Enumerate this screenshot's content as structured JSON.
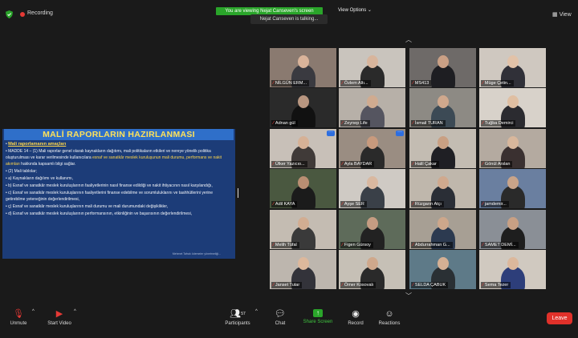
{
  "topbar": {
    "recording_label": "Recording",
    "view_notice": "You are viewing Nejat Canseven's screen",
    "view_options_label": "View Options",
    "talking_label": "Nejat Canseven is talking...",
    "view_button_label": "View"
  },
  "slide": {
    "title": "MALİ RAPORLARIN HAZIRLANMASI",
    "subtitle": "Mali raporlamanın amaçları",
    "paragraph_1_lead": "MADDE 14 – (1) Mali raporlar genel olarak kaynakların dağıtımı, mali politikaların etkileri ve nereye yönelik politika oluşturulması ve karar verilmesinde kullanıcılara",
    "paragraph_1_hl": "esnaf ve sanatkâr meslek kuruluşunun mali durumu, performans ve nakit akımları",
    "paragraph_1_tail": "hakkında kapsamlı bilgi sağlar.",
    "item_2": "(2) Mali tablolar;",
    "item_a": "a) Kaynakların dağılımı ve kullanımı,",
    "item_b": "b) Esnaf ve sanatkâr meslek kuruluşlarının faaliyetlerinin nasıl finanse edildiği ve nakit ihtiyacının nasıl karşılandığı,",
    "item_c": "c) Esnaf ve sanatkâr meslek kuruluşlarının faaliyetlerini finanse edebilme ve sorumluluklarını ve taahhütlerini yerine getirebilme yeteneğinin değerlendirilmesi,",
    "item_c2": "ç) Esnaf ve sanatkâr meslek kuruluşlarının mali durumu ve mali durumundaki değişiklikler,",
    "item_d": "d) Esnaf ve sanatkâr meslek kuruluşlarının performansının, etkinliğinin ve başarısının değerlendirilmesi,",
    "footnote": "Mehmet Tafralı ödemeler yönetmeliği..."
  },
  "participants": [
    {
      "name": "NİLGÜN ERM...",
      "scene": "#8a7a70",
      "body": "#3a3a40",
      "head": "#d9b39a"
    },
    {
      "name": "Özlem Altı...",
      "scene": "#c9c4bd",
      "body": "#2a2a2a",
      "head": "#d8b59c"
    },
    {
      "name": "MS413",
      "scene": "#6e6a68",
      "body": "#1e1e22",
      "head": "#caa085"
    },
    {
      "name": "Müge Çetin...",
      "scene": "#cfc8c0",
      "body": "#303038",
      "head": "#e2c2a8"
    },
    {
      "name": "Adnan gül",
      "scene": "#2a2a2a",
      "body": "#111111",
      "head": "#b89680"
    },
    {
      "name": "Zeynep Life",
      "scene": "#b7b0a8",
      "body": "#555560",
      "head": "#d0ab90"
    },
    {
      "name": "İsmail TURAN",
      "scene": "#8d8a84",
      "body": "#3c4a55",
      "head": "#cfa88d"
    },
    {
      "name": "Tuğba Demirci",
      "scene": "#d8d2ca",
      "body": "#2b2b30",
      "head": "#e0bfa2"
    },
    {
      "name": "Ülker Yazıcıo...",
      "scene": "#c8c0b8",
      "body": "#403a38",
      "head": "#d6b196"
    },
    {
      "name": "Ayla BAYDAR",
      "scene": "#9a8d82",
      "body": "#2a2a2a",
      "head": "#c89a7d"
    },
    {
      "name": "Halil Çakar",
      "scene": "#c3bcb2",
      "body": "#1f1f24",
      "head": "#c9a083"
    },
    {
      "name": "Gönül Arslan",
      "scene": "#b4aaa0",
      "body": "#3a3030",
      "head": "#d8b79c"
    },
    {
      "name": "Adil KAYA",
      "scene": "#4a5840",
      "body": "#1b1b1b",
      "head": "#b98e72"
    },
    {
      "name": "Ayşe SER",
      "scene": "#cfcac4",
      "body": "#3a4048",
      "head": "#d9b8a0"
    },
    {
      "name": "Rüzgarın Atçı",
      "scene": "#bfb7ac",
      "body": "#2a2e36",
      "head": "#d0a98e"
    },
    {
      "name": "jamdemir...",
      "scene": "#6a7fa0",
      "body": "#2a2a2a",
      "head": "#c9a489"
    },
    {
      "name": "Melih Tüfal",
      "scene": "#c4bcb2",
      "body": "#3a3a3a",
      "head": "#d2ad92"
    },
    {
      "name": "Figen Gürsoy",
      "scene": "#5e6b5a",
      "body": "#222222",
      "head": "#c59c82"
    },
    {
      "name": "Abdurrahman G...",
      "scene": "#a79f94",
      "body": "#2c3a50",
      "head": "#cda78b"
    },
    {
      "name": "SAMET DEMİ...",
      "scene": "#8a8f96",
      "body": "#1e1e1e",
      "head": "#c8a084"
    },
    {
      "name": "Janset Tutar",
      "scene": "#bdb6ae",
      "body": "#33333a",
      "head": "#ddb89c"
    },
    {
      "name": "Ömer Kosovalı",
      "scene": "#c6c0b6",
      "body": "#2a2a2a",
      "head": "#cfa88c"
    },
    {
      "name": "SELDA ÇABUK",
      "scene": "#5e7a88",
      "body": "#2a3034",
      "head": "#d5b094"
    },
    {
      "name": "Sema Tezer",
      "scene": "#d0c9c0",
      "body": "#2d3e7a",
      "head": "#dcb89c"
    }
  ],
  "toolbar": {
    "unmute_label": "Unmute",
    "start_video_label": "Start Video",
    "participants_label": "Participants",
    "participants_count": "57",
    "chat_label": "Chat",
    "share_screen_label": "Share Screen",
    "record_label": "Record",
    "reactions_label": "Reactions",
    "leave_label": "Leave"
  }
}
